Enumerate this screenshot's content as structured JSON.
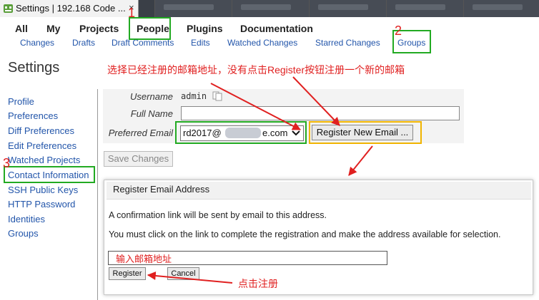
{
  "browser": {
    "tab_title": "Settings | 192.168 Code ...",
    "close_glyph": "×"
  },
  "top_nav": [
    "All",
    "My",
    "Projects",
    "People",
    "Plugins",
    "Documentation"
  ],
  "sub_nav": [
    "Changes",
    "Drafts",
    "Draft Comments",
    "Edits",
    "Watched Changes",
    "Starred Changes",
    "Groups"
  ],
  "page_title": "Settings",
  "sidebar": [
    "Profile",
    "Preferences",
    "Diff Preferences",
    "Edit Preferences",
    "Watched Projects",
    "Contact Information",
    "SSH Public Keys",
    "HTTP Password",
    "Identities",
    "Groups"
  ],
  "form": {
    "username_label": "Username",
    "username_value": "admin",
    "fullname_label": "Full Name",
    "fullname_value": "",
    "email_label": "Preferred Email",
    "email_prefix": "rd2017@",
    "email_suffix": "e.com",
    "register_new_email": "Register New Email ...",
    "save_changes": "Save Changes"
  },
  "dialog": {
    "title": "Register Email Address",
    "line1": "A confirmation link will be sent by email to this address.",
    "line2": "You must click on the link to complete the registration and make the address available for selection.",
    "input_placeholder": "输入邮箱地址",
    "register": "Register",
    "cancel": "Cancel"
  },
  "annotations": {
    "num1": "1",
    "num2": "2",
    "num3": "3",
    "note_top": "选择已经注册的邮箱地址，没有点击Register按钮注册一个新的邮箱",
    "note_bottom": "点击注册",
    "color": "#e02020"
  },
  "colors": {
    "link": "#2255aa",
    "highlight_green": "#22aa22",
    "highlight_orange": "#f0b400"
  }
}
